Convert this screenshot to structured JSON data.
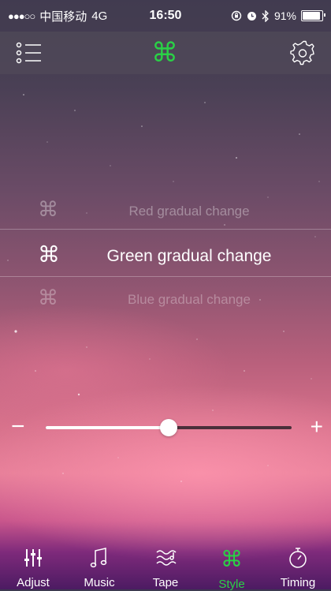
{
  "status_bar": {
    "signal": "●●●○○",
    "carrier": "中国移动",
    "network": "4G",
    "time": "16:50",
    "battery": "91%",
    "battery_level": 0.91
  },
  "header": {
    "menu_icon": "menu-list-icon",
    "logo_icon": "command-icon",
    "logo_glyph": "⌘",
    "settings_icon": "gear-icon"
  },
  "picker": {
    "glyph": "⌘",
    "options": [
      {
        "label": "Red gradual change"
      },
      {
        "label": "Green gradual change"
      },
      {
        "label": "Blue  gradual change"
      }
    ],
    "selected_index": 1
  },
  "slider": {
    "minus": "−",
    "plus": "+",
    "value": 0.5
  },
  "tabs": [
    {
      "label": "Adjust",
      "icon": "sliders-icon"
    },
    {
      "label": "Music",
      "icon": "music-note-icon"
    },
    {
      "label": "Tape",
      "icon": "tape-icon"
    },
    {
      "label": "Style",
      "icon": "command-icon",
      "glyph": "⌘"
    },
    {
      "label": "Timing",
      "icon": "stopwatch-icon"
    }
  ],
  "colors": {
    "accent": "#2ad146",
    "bar": "#504a58"
  }
}
